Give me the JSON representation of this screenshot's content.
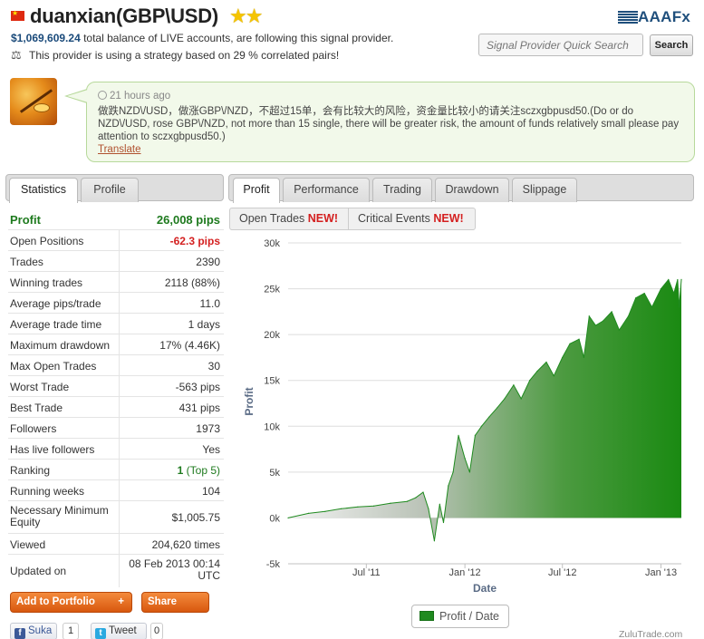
{
  "header": {
    "title": "duanxian(GBP\\USD)",
    "stars": "★★",
    "balance_amount": "$1,069,609.24",
    "balance_text": " total balance of LIVE accounts, are following this signal provider.",
    "correlation_text": "This provider is using a strategy based on 29 % correlated pairs!",
    "brand_aaa": "AAA",
    "brand_fx": "Fx",
    "search_placeholder": "Signal Provider Quick Search",
    "search_button": "Search"
  },
  "comment": {
    "time": "21 hours ago",
    "text": "做跌NZD\\/USD，做涨GBP\\/NZD，不超过15单，会有比较大的风险，资金量比较小的请关注sczxgbpusd50.(Do or do NZD\\/USD, rose GBP\\/NZD, not more than 15 single, there will be greater risk, the amount of funds relatively small please pay attention to sczxgbpusd50.)",
    "translate_link": "Translate"
  },
  "left_tabs": [
    "Statistics",
    "Profile"
  ],
  "right_tabs": [
    "Profit",
    "Performance",
    "Trading",
    "Drawdown",
    "Slippage"
  ],
  "sub_tabs": {
    "open_trades": "Open Trades ",
    "critical_events": "Critical Events ",
    "new_badge": "NEW!"
  },
  "stats": {
    "profit_label": "Profit",
    "profit_value": "26,008 pips",
    "open_positions_label": "Open Positions",
    "open_positions_value": "-62.3 pips",
    "trades_label": "Trades",
    "trades_value": "2390",
    "winning_label": "Winning trades",
    "winning_value": "2118 (88%)",
    "avg_pips_label": "Average pips/trade",
    "avg_pips_value": "11.0",
    "avg_time_label": "Average trade time",
    "avg_time_value": "1 days",
    "max_dd_label": "Maximum drawdown",
    "max_dd_value": "17% (4.46K)",
    "max_open_label": "Max Open Trades",
    "max_open_value": "30",
    "worst_label": "Worst Trade",
    "worst_value": "-563 pips",
    "best_label": "Best Trade",
    "best_value": "431 pips",
    "followers_label": "Followers",
    "followers_value": "1973",
    "live_label": "Has live followers",
    "live_value": "Yes",
    "ranking_label": "Ranking",
    "ranking_value": "1",
    "ranking_extra": " (Top 5)",
    "weeks_label": "Running weeks",
    "weeks_value": "104",
    "min_equity_label": "Necessary Minimum Equity",
    "min_equity_value": "$1,005.75",
    "viewed_label": "Viewed",
    "viewed_value": "204,620 times",
    "updated_label": "Updated on",
    "updated_value": "08 Feb 2013 00:14 UTC"
  },
  "actions": {
    "add_portfolio": "Add to Portfolio",
    "add_plus": "+",
    "share": "Share"
  },
  "social": {
    "fb_label": "Suka",
    "fb_count": "1",
    "tweet_label": "Tweet",
    "tweet_count": "0"
  },
  "legend_label": "Profit / Date",
  "credit": "ZuluTrade.com",
  "colors": {
    "profit_green": "#1e7a1e",
    "negative_red": "#d42020",
    "chart_green": "#1f8a1f"
  },
  "chart_data": {
    "type": "area",
    "xlabel": "Date",
    "ylabel": "Profit",
    "ylim": [
      -5000,
      30000
    ],
    "yticks": [
      -5000,
      0,
      5000,
      10000,
      15000,
      20000,
      25000,
      30000
    ],
    "ytick_labels": [
      "-5k",
      "0k",
      "5k",
      "10k",
      "15k",
      "20k",
      "25k",
      "30k"
    ],
    "xticks": [
      "2011-07-01",
      "2012-01-01",
      "2012-07-01",
      "2013-01-01"
    ],
    "xtick_labels": [
      "Jul '11",
      "Jan '12",
      "Jul '12",
      "Jan '13"
    ],
    "xlim": [
      "2011-02-05",
      "2013-02-08"
    ],
    "grid": "horizontal",
    "series": [
      {
        "x": [
          "2011-02-05",
          "2011-03-15",
          "2011-04-15",
          "2011-05-15",
          "2011-06-15",
          "2011-07-15",
          "2011-08-15",
          "2011-09-15",
          "2011-10-01",
          "2011-10-15",
          "2011-10-25",
          "2011-11-05",
          "2011-11-15",
          "2011-11-22",
          "2011-12-01",
          "2011-12-10",
          "2011-12-20",
          "2012-01-01",
          "2012-01-10",
          "2012-01-20",
          "2012-02-01",
          "2012-02-15",
          "2012-03-01",
          "2012-03-15",
          "2012-04-01",
          "2012-04-15",
          "2012-05-01",
          "2012-05-15",
          "2012-06-01",
          "2012-06-15",
          "2012-07-01",
          "2012-07-15",
          "2012-08-01",
          "2012-08-10",
          "2012-08-20",
          "2012-09-01",
          "2012-09-15",
          "2012-10-01",
          "2012-10-15",
          "2012-11-01",
          "2012-11-15",
          "2012-12-01",
          "2012-12-15",
          "2013-01-01",
          "2013-01-15",
          "2013-01-25",
          "2013-02-01",
          "2013-02-04",
          "2013-02-08"
        ],
        "y": [
          0,
          500,
          700,
          1000,
          1200,
          1300,
          1600,
          1800,
          2200,
          2800,
          1000,
          -2500,
          1500,
          -500,
          3500,
          5000,
          9000,
          6500,
          5000,
          9000,
          10000,
          11000,
          12000,
          13000,
          14500,
          13000,
          15000,
          16000,
          17000,
          15500,
          17500,
          19000,
          19500,
          17500,
          22000,
          21000,
          21500,
          22500,
          20500,
          22000,
          24000,
          24500,
          23000,
          25000,
          26000,
          24500,
          26000,
          23000,
          26008
        ]
      }
    ]
  }
}
